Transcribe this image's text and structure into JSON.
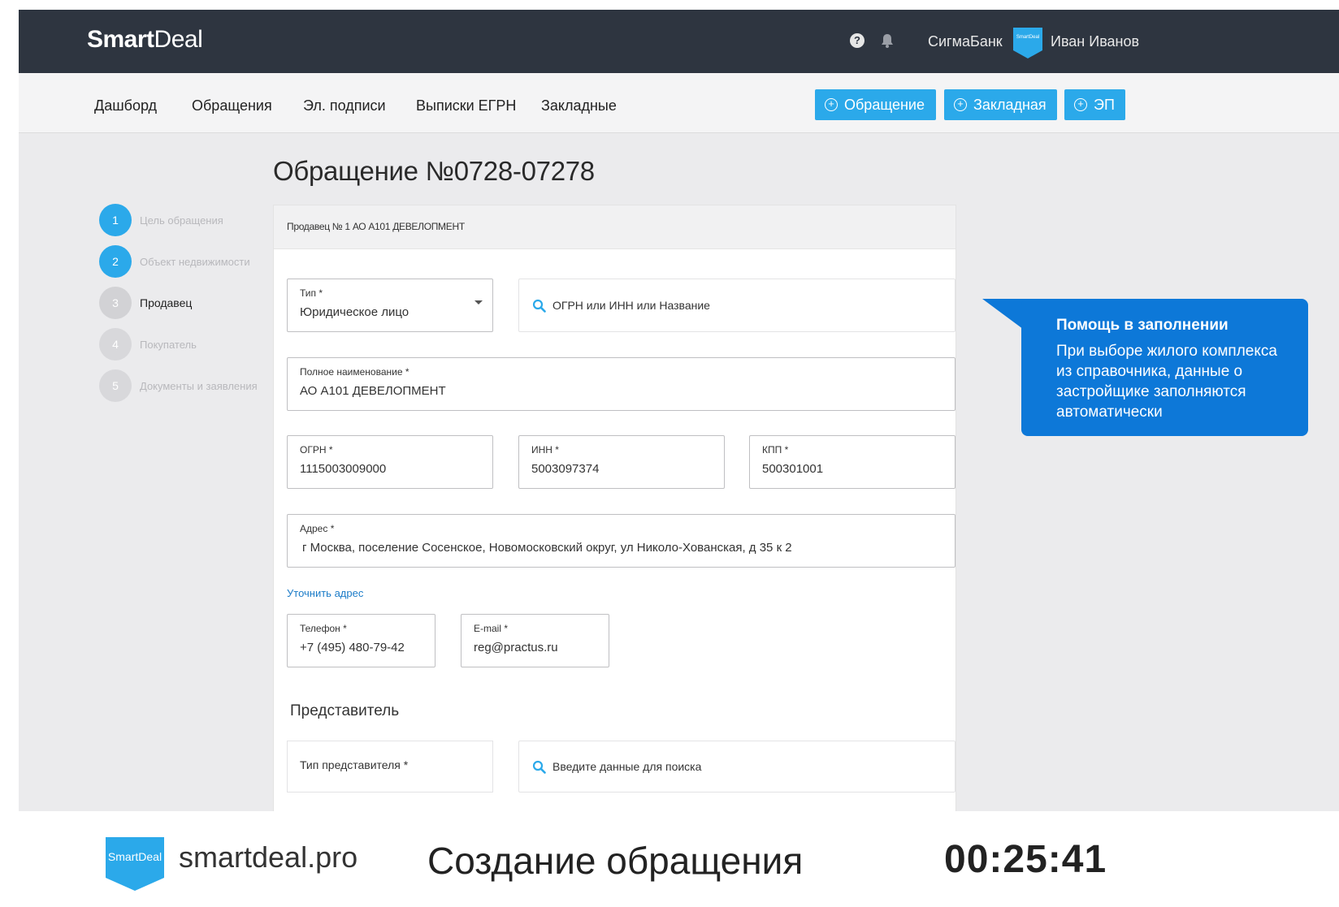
{
  "header": {
    "logo_bold": "Smart",
    "logo_light": "Deal",
    "help": "?",
    "bank": "СигмаБанк",
    "avatar_text": "SmartDeal",
    "user": "Иван Иванов"
  },
  "nav": {
    "items": [
      "Дашборд",
      "Обращения",
      "Эл. подписи",
      "Выписки ЕГРН",
      "Закладные"
    ],
    "buttons": [
      "Обращение",
      "Закладная",
      "ЭП"
    ],
    "plus": "+"
  },
  "steps": [
    {
      "num": "1",
      "label": "Цель обращения",
      "state": "done"
    },
    {
      "num": "2",
      "label": "Объект недвижимости",
      "state": "done"
    },
    {
      "num": "3",
      "label": "Продавец",
      "state": "active"
    },
    {
      "num": "4",
      "label": "Покупатель",
      "state": "pending"
    },
    {
      "num": "5",
      "label": "Документы и заявления",
      "state": "pending"
    }
  ],
  "page_title": "Обращение №0728-07278",
  "card": {
    "header": "Продавец № 1 АО А101 ДЕВЕЛОПМЕНТ",
    "type_label": "Тип *",
    "type_value": "Юридическое лицо",
    "search_placeholder": "ОГРН или ИНН или Название",
    "fullname_label": "Полное наименование *",
    "fullname_value": "АО А101 ДЕВЕЛОПМЕНТ",
    "ogrn_label": "ОГРН *",
    "ogrn_value": "1115003009000",
    "inn_label": "ИНН *",
    "inn_value": "5003097374",
    "kpp_label": "КПП *",
    "kpp_value": "500301001",
    "address_label": "Адрес *",
    "address_value": "г Москва, поселение Сосенское, Новомосковский округ, ул Николо-Хованская, д 35 к 2",
    "refine_link": "Уточнить адрес",
    "phone_label": "Телефон *",
    "phone_value": "+7 (495) 480-79-42",
    "email_label": "E-mail *",
    "email_value": "reg@practus.ru",
    "rep_section": "Представитель",
    "rep_type_label": "Тип представителя *",
    "rep_search_placeholder": "Введите данные для поиска"
  },
  "tooltip": {
    "title": "Помощь в заполнении",
    "body": "При выборе жилого комплекса из справочника, данные о застройщике заполняются автоматически"
  },
  "footer": {
    "logo_text": "SmartDeal",
    "site": "smartdeal.pro",
    "caption": "Создание обращения",
    "timer": "00:25:41"
  },
  "colors": {
    "header_bg": "#2e3540",
    "accent": "#2ba9ea",
    "tooltip_bg": "#0d78d8",
    "link": "#1c7cc8"
  }
}
